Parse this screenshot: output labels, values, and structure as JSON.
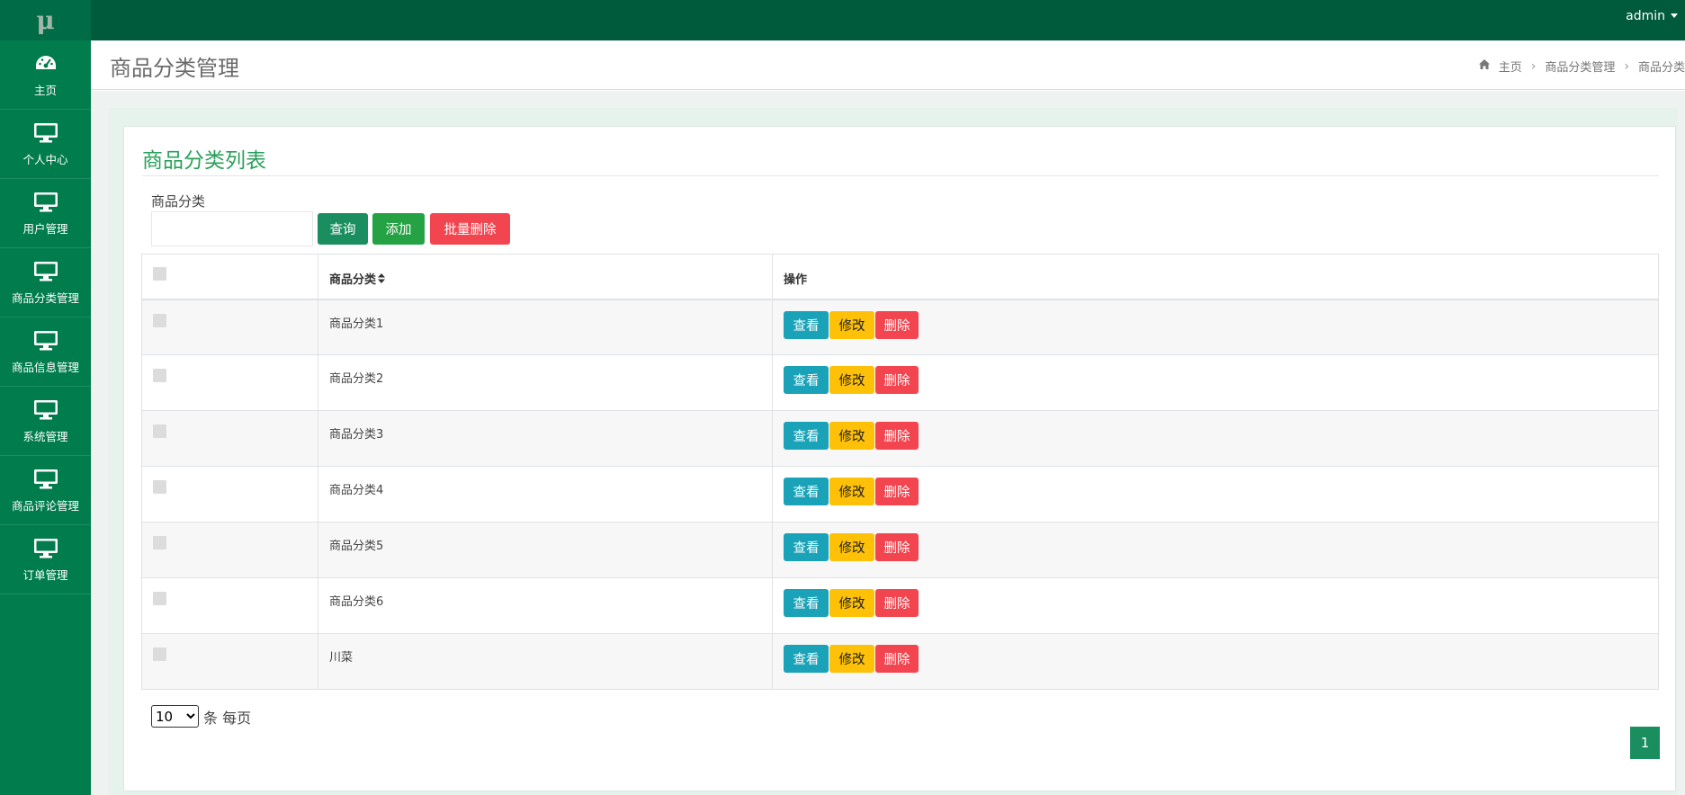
{
  "topbar": {
    "logo_text": "μ",
    "user_name": "admin"
  },
  "sidebar": {
    "items": [
      {
        "label": "主页",
        "icon": "dashboard-icon"
      },
      {
        "label": "个人中心",
        "icon": "monitor-icon"
      },
      {
        "label": "用户管理",
        "icon": "monitor-icon"
      },
      {
        "label": "商品分类管理",
        "icon": "monitor-icon"
      },
      {
        "label": "商品信息管理",
        "icon": "monitor-icon"
      },
      {
        "label": "系统管理",
        "icon": "monitor-icon"
      },
      {
        "label": "商品评论管理",
        "icon": "monitor-icon"
      },
      {
        "label": "订单管理",
        "icon": "monitor-icon"
      }
    ]
  },
  "header": {
    "title": "商品分类管理",
    "breadcrumb": [
      "主页",
      "商品分类管理",
      "商品分类"
    ]
  },
  "card": {
    "title": "商品分类列表",
    "filter_label": "商品分类",
    "filter_value": "",
    "buttons": {
      "query": "查询",
      "add": "添加",
      "batch_delete": "批量删除"
    }
  },
  "table": {
    "headers": {
      "name": "商品分类",
      "actions": "操作"
    },
    "rows": [
      {
        "name": "商品分类1"
      },
      {
        "name": "商品分类2"
      },
      {
        "name": "商品分类3"
      },
      {
        "name": "商品分类4"
      },
      {
        "name": "商品分类5"
      },
      {
        "name": "商品分类6"
      },
      {
        "name": "川菜"
      }
    ],
    "row_actions": {
      "view": "查看",
      "edit": "修改",
      "delete": "删除"
    }
  },
  "pagination": {
    "page_size": "10",
    "page_size_suffix": "条 每页",
    "current_page": "1"
  },
  "colors": {
    "topbar": "#005a3c",
    "sidebar": "#007c4d",
    "accent": "#1b8e5f",
    "title_green": "#2aa05b",
    "view_button": "#19a2b8",
    "edit_button": "#ffc107",
    "delete_button": "#f2454f"
  }
}
